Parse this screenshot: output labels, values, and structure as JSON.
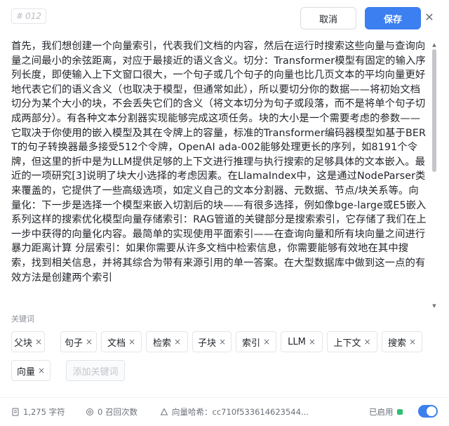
{
  "header": {
    "chunk_id_prefix": "#",
    "chunk_id": "012",
    "cancel_label": "取消",
    "save_label": "保存",
    "close_glyph": "✕"
  },
  "content": {
    "text": "首先，我们想创建一个向量索引，代表我们文档的内容，然后在运行时搜索这些向量与查询向量之间最小的余弦距离，对应于最接近的语义含义。切分：Transformer模型有固定的输入序列长度，即使输入上下文窗口很大，一个句子或几个句子的向量也比几页文本的平均向量更好地代表它们的语义含义（也取决于模型，但通常如此），所以要切分你的数据——将初始文档切分为某个大小的块，不会丢失它们的含义（将文本切分为句子或段落，而不是将单个句子切成两部分）。有各种文本分割器实现能够完成这项任务。块的大小是一个需要考虑的参数——它取决于你使用的嵌入模型及其在令牌上的容量，标准的Transformer编码器模型如基于BERT的句子转换器最多接受512个令牌，OpenAI ada-002能够处理更长的序列，如8191个令牌，但这里的折中是为LLM提供足够的上下文进行推理与执行搜索的足够具体的文本嵌入。最近的一项研究[3]说明了块大小选择的考虑因素。在LlamaIndex中，这是通过NodeParser类来覆盖的，它提供了一些高级选项，如定义自己的文本分割器、元数据、节点/块关系等。向量化：下一步是选择一个模型来嵌入切割后的块——有很多选择，例如像bge-large或E5嵌入系列这样的搜索优化模型向量存储索引：RAG管道的关键部分是搜索索引，它存储了我们在上一步中获得的向量化内容。最简单的实现使用平面索引——在查询向量和所有块向量之间进行暴力距离计算 分层索引：如果你需要从许多文档中检索信息，你需要能够有效地在其中搜索，找到相关信息，并将其综合为带有来源引用的单一答案。在大型数据库中做到这一点的有效方法是创建两个索引"
  },
  "keywords": {
    "label": "关键词",
    "items": [
      "父块",
      "句子",
      "文档",
      "检索",
      "子块",
      "索引",
      "LLM",
      "上下文",
      "搜索",
      "向量"
    ],
    "remove_glyph": "×",
    "add_placeholder": "添加关键词"
  },
  "footer": {
    "char_count": "1,275 字符",
    "recall_count": "0 召回次数",
    "hash_label": "向量哈希：cc710f533614623544...",
    "status_label": "已启用",
    "enabled": true,
    "accent_color": "#3c7ff0",
    "status_color": "#2fbf71"
  }
}
